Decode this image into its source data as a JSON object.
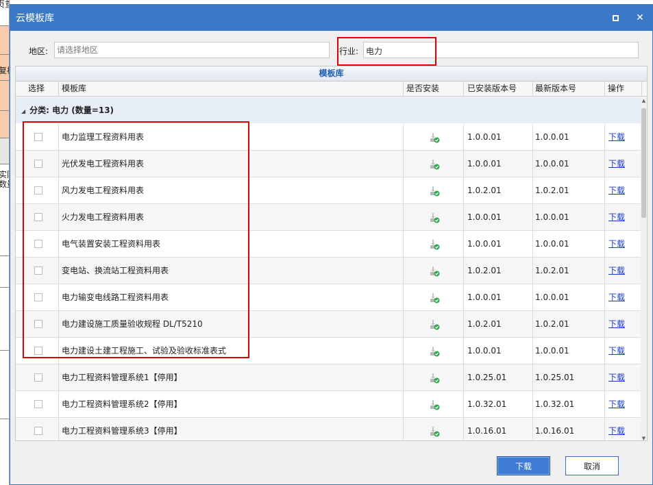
{
  "background": {
    "title_fragment": "质量验收记录",
    "text1": "复栏",
    "text2": "实际",
    "text3": "数量"
  },
  "dialog": {
    "title": "云模板库",
    "maximize_icon": "maximize-icon",
    "close_icon": "close-icon",
    "close_glyph": "✕"
  },
  "filters": {
    "region_label": "地区:",
    "region_placeholder": "请选择地区",
    "industry_label": "行业:",
    "industry_value": "电力"
  },
  "grid": {
    "caption": "模板库",
    "columns": [
      "选择",
      "模板库",
      "是否安装",
      "已安装版本号",
      "最新版本号",
      "操作"
    ],
    "group_label": "分类: 电力 (数量=13)",
    "group_caret": "◢",
    "rows": [
      {
        "name": "电力监理工程资料用表",
        "installed_version": "1.0.0.01",
        "latest_version": "1.0.0.01",
        "action": "下载"
      },
      {
        "name": "光伏发电工程资料用表",
        "installed_version": "1.0.0.01",
        "latest_version": "1.0.0.01",
        "action": "下载"
      },
      {
        "name": "风力发电工程资料用表",
        "installed_version": "1.0.2.01",
        "latest_version": "1.0.2.01",
        "action": "下载"
      },
      {
        "name": "火力发电工程资料用表",
        "installed_version": "1.0.0.01",
        "latest_version": "1.0.0.01",
        "action": "下载"
      },
      {
        "name": "电气装置安装工程资料用表",
        "installed_version": "1.0.0.01",
        "latest_version": "1.0.0.01",
        "action": "下载"
      },
      {
        "name": "变电站、换流站工程资料用表",
        "installed_version": "1.0.2.01",
        "latest_version": "1.0.2.01",
        "action": "下载"
      },
      {
        "name": "电力输变电线路工程资料用表",
        "installed_version": "1.0.0.01",
        "latest_version": "1.0.0.01",
        "action": "下载"
      },
      {
        "name": "电力建设施工质量验收规程 DL/T5210",
        "installed_version": "1.0.2.01",
        "latest_version": "1.0.2.01",
        "action": "下载"
      },
      {
        "name": "电力建设土建工程施工、试验及验收标准表式",
        "installed_version": "1.0.0.01",
        "latest_version": "1.0.0.01",
        "action": "下载"
      },
      {
        "name": "电力工程资料管理系统1【停用】",
        "installed_version": "1.0.25.01",
        "latest_version": "1.0.25.01",
        "action": "下载"
      },
      {
        "name": "电力工程资料管理系统2【停用】",
        "installed_version": "1.0.32.01",
        "latest_version": "1.0.32.01",
        "action": "下载"
      },
      {
        "name": "电力工程资料管理系统3【停用】",
        "installed_version": "1.0.16.01",
        "latest_version": "1.0.16.01",
        "action": "下载"
      }
    ]
  },
  "footer": {
    "download_label": "下载",
    "cancel_label": "取消"
  },
  "colors": {
    "titlebar": "#3c78c8",
    "annotation": "#e00000",
    "link": "#1c3dc8"
  }
}
